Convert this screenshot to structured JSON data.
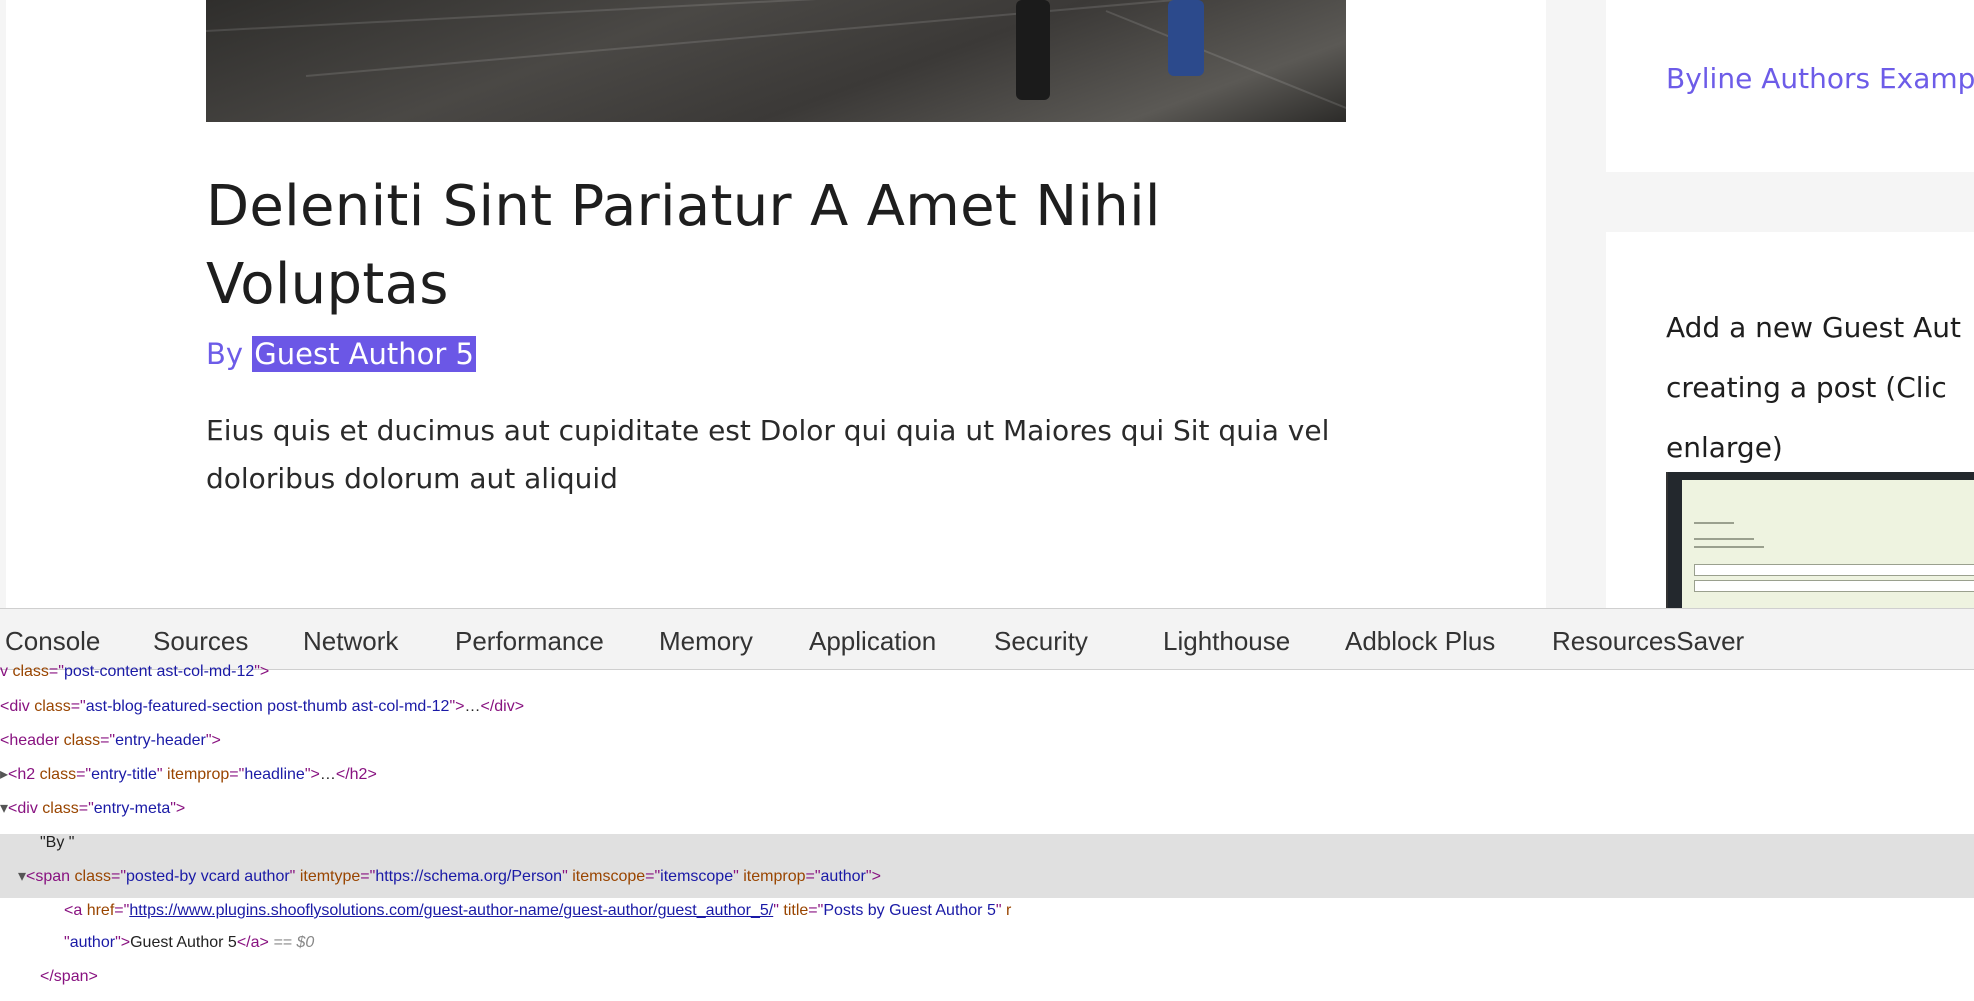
{
  "page": {
    "post_title": "Deleniti Sint Pariatur A Amet Nihil Voluptas",
    "byline_prefix": "By ",
    "byline_author": "Guest Author 5",
    "excerpt": "Eius quis et ducimus aut cupiditate est Dolor qui quia ut Maiores qui Sit quia vel doloribus dolorum aut aliquid",
    "sidebar": {
      "link": "Byline Authors Examp",
      "text_line1": "Add a new Guest Aut",
      "text_line2": "creating a post (Clic",
      "text_line3": "enlarge)"
    },
    "colors": {
      "accent": "#6d5ce8",
      "highlight": "#6b57e6"
    }
  },
  "devtools": {
    "tabs": [
      "Console",
      "Sources",
      "Network",
      "Performance",
      "Memory",
      "Application",
      "Security",
      "Lighthouse",
      "Adblock Plus",
      "ResourcesSaver"
    ],
    "dom": {
      "r0_frag": "v ",
      "r0_attr": "class",
      "r0_val": "post-content ast-col-md-12",
      "r1_tag": "div",
      "r1_attr": "class",
      "r1_val": "ast-blog-featured-section post-thumb ast-col-md-12",
      "r1_close": "</div>",
      "r2_tag": "header",
      "r2_attr": "class",
      "r2_val": "entry-header",
      "r3_tag": "h2",
      "r3_attr1": "class",
      "r3_val1": "entry-title",
      "r3_attr2": "itemprop",
      "r3_val2": "headline",
      "r3_close": "</h2>",
      "r4_tag": "div",
      "r4_attr": "class",
      "r4_val": "entry-meta",
      "r5_text": "\"By \"",
      "r6_tag": "span",
      "r6_attr1": "class",
      "r6_val1": "posted-by vcard author",
      "r6_attr2": "itemtype",
      "r6_val2": "https://schema.org/Person",
      "r6_attr3": "itemscope",
      "r6_val3": "itemscope",
      "r6_attr4": "itemprop",
      "r6_val4": "author",
      "r7_tag": "a",
      "r7_attr1": "href",
      "r7_href": "https://www.plugins.shooflysolutions.com/guest-author-name/guest-author/guest_author_5/",
      "r7_attr2": "title",
      "r7_val2": "Posts by Guest Author 5",
      "r7_attr3_frag": "r",
      "r8_val": "author",
      "r8_text": "Guest Author 5",
      "r8_close": "</a>",
      "r8_eq": "== ",
      "r8_dollar": "$0",
      "r9_close": "</span>"
    }
  }
}
